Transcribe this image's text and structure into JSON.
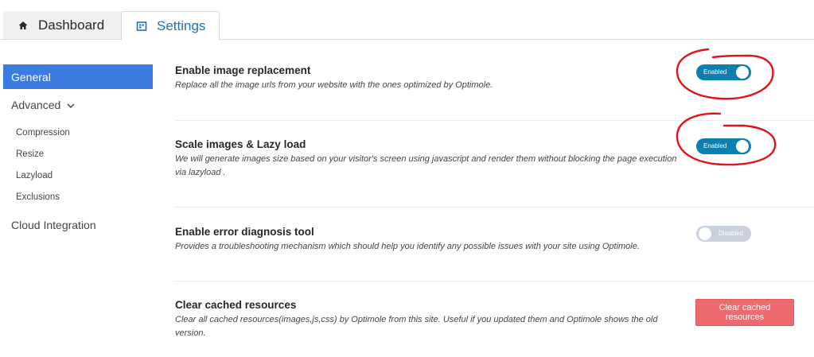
{
  "tabs": {
    "dashboard": {
      "label": "Dashboard",
      "icon": "home-icon"
    },
    "settings": {
      "label": "Settings",
      "icon": "settings-icon"
    }
  },
  "sidebar": {
    "general": "General",
    "advanced": "Advanced",
    "sub_items": [
      "Compression",
      "Resize",
      "Lazyload",
      "Exclusions"
    ],
    "cloud": "Cloud Integration"
  },
  "settings": {
    "image_replacement": {
      "title": "Enable image replacement",
      "desc": "Replace all the image urls from your website with the ones optimized by Optimole.",
      "toggle": "Enabled"
    },
    "lazy_load": {
      "title": "Scale images & Lazy load",
      "desc": "We will generate images size based on your visitor's screen using javascript and render them without blocking the page execution via lazyload .",
      "toggle": "Enabled"
    },
    "error_diag": {
      "title": "Enable error diagnosis tool",
      "desc": "Provides a troubleshooting mechanism which should help you identify any possible issues with your site using Optimole.",
      "toggle": "Disabled"
    },
    "clear_cache": {
      "title": "Clear cached resources",
      "desc": "Clear all cached resources(images,js,css) by Optimole from this site. Useful if you updated them and Optimole shows the old version.",
      "button": "Clear cached resources"
    }
  },
  "colors": {
    "accent": "#3b7ce0",
    "toggle_on": "#0b7fae",
    "toggle_off": "#c9d2dc",
    "danger": "#ee6a6f",
    "annotation": "#e0141b"
  }
}
